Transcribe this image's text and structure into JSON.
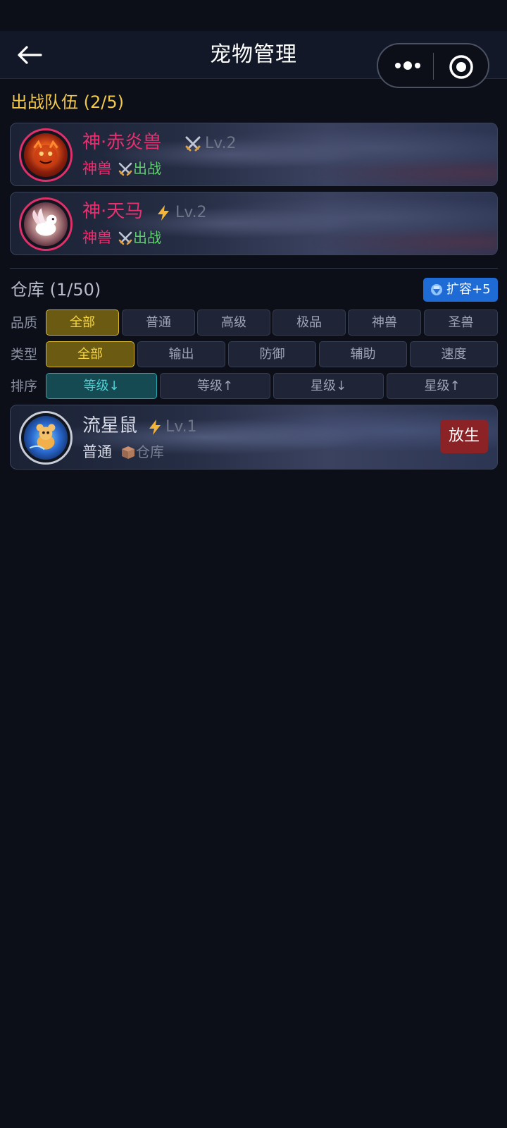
{
  "nav": {
    "title": "宠物管理",
    "back_icon": "back-arrow-icon",
    "more_icon": "more-dots-icon",
    "close_icon": "close-miniprogram-icon"
  },
  "battle_team": {
    "title": "出战队伍 (2/5)",
    "pets": [
      {
        "name": "神·赤炎兽",
        "type_icon": "crossed-swords-icon",
        "level": "Lv.2",
        "rarity": "神兽",
        "status_icon": "crossed-swords-icon",
        "status": "出战"
      },
      {
        "name": "神·天马",
        "type_icon": "lightning-icon",
        "level": "Lv.2",
        "rarity": "神兽",
        "status_icon": "crossed-swords-icon",
        "status": "出战"
      }
    ]
  },
  "storage": {
    "title": "仓库 (1/50)",
    "expand_button": "扩容+5",
    "expand_icon": "gem-icon",
    "filters": {
      "quality": {
        "label": "品质",
        "options": [
          "全部",
          "普通",
          "高级",
          "极品",
          "神兽",
          "圣兽"
        ],
        "selected": "全部"
      },
      "type": {
        "label": "类型",
        "options": [
          "全部",
          "输出",
          "防御",
          "辅助",
          "速度"
        ],
        "selected": "全部"
      },
      "sort": {
        "label": "排序",
        "options": [
          "等级↓",
          "等级↑",
          "星级↓",
          "星级↑"
        ],
        "selected": "等级↓"
      }
    },
    "pets": [
      {
        "name": "流星鼠",
        "type_icon": "lightning-icon",
        "level": "Lv.1",
        "rarity": "普通",
        "status_icon": "box-icon",
        "status": "仓库",
        "release_button": "放生"
      }
    ]
  },
  "colors": {
    "background": "#0c0f18",
    "gold": "#f2c94c",
    "divine_pink": "#e8306f",
    "battle_green": "#5dd36b",
    "teal": "#2ba9b3",
    "release_red": "#8a2226",
    "expand_blue": "#1e6bd6"
  }
}
